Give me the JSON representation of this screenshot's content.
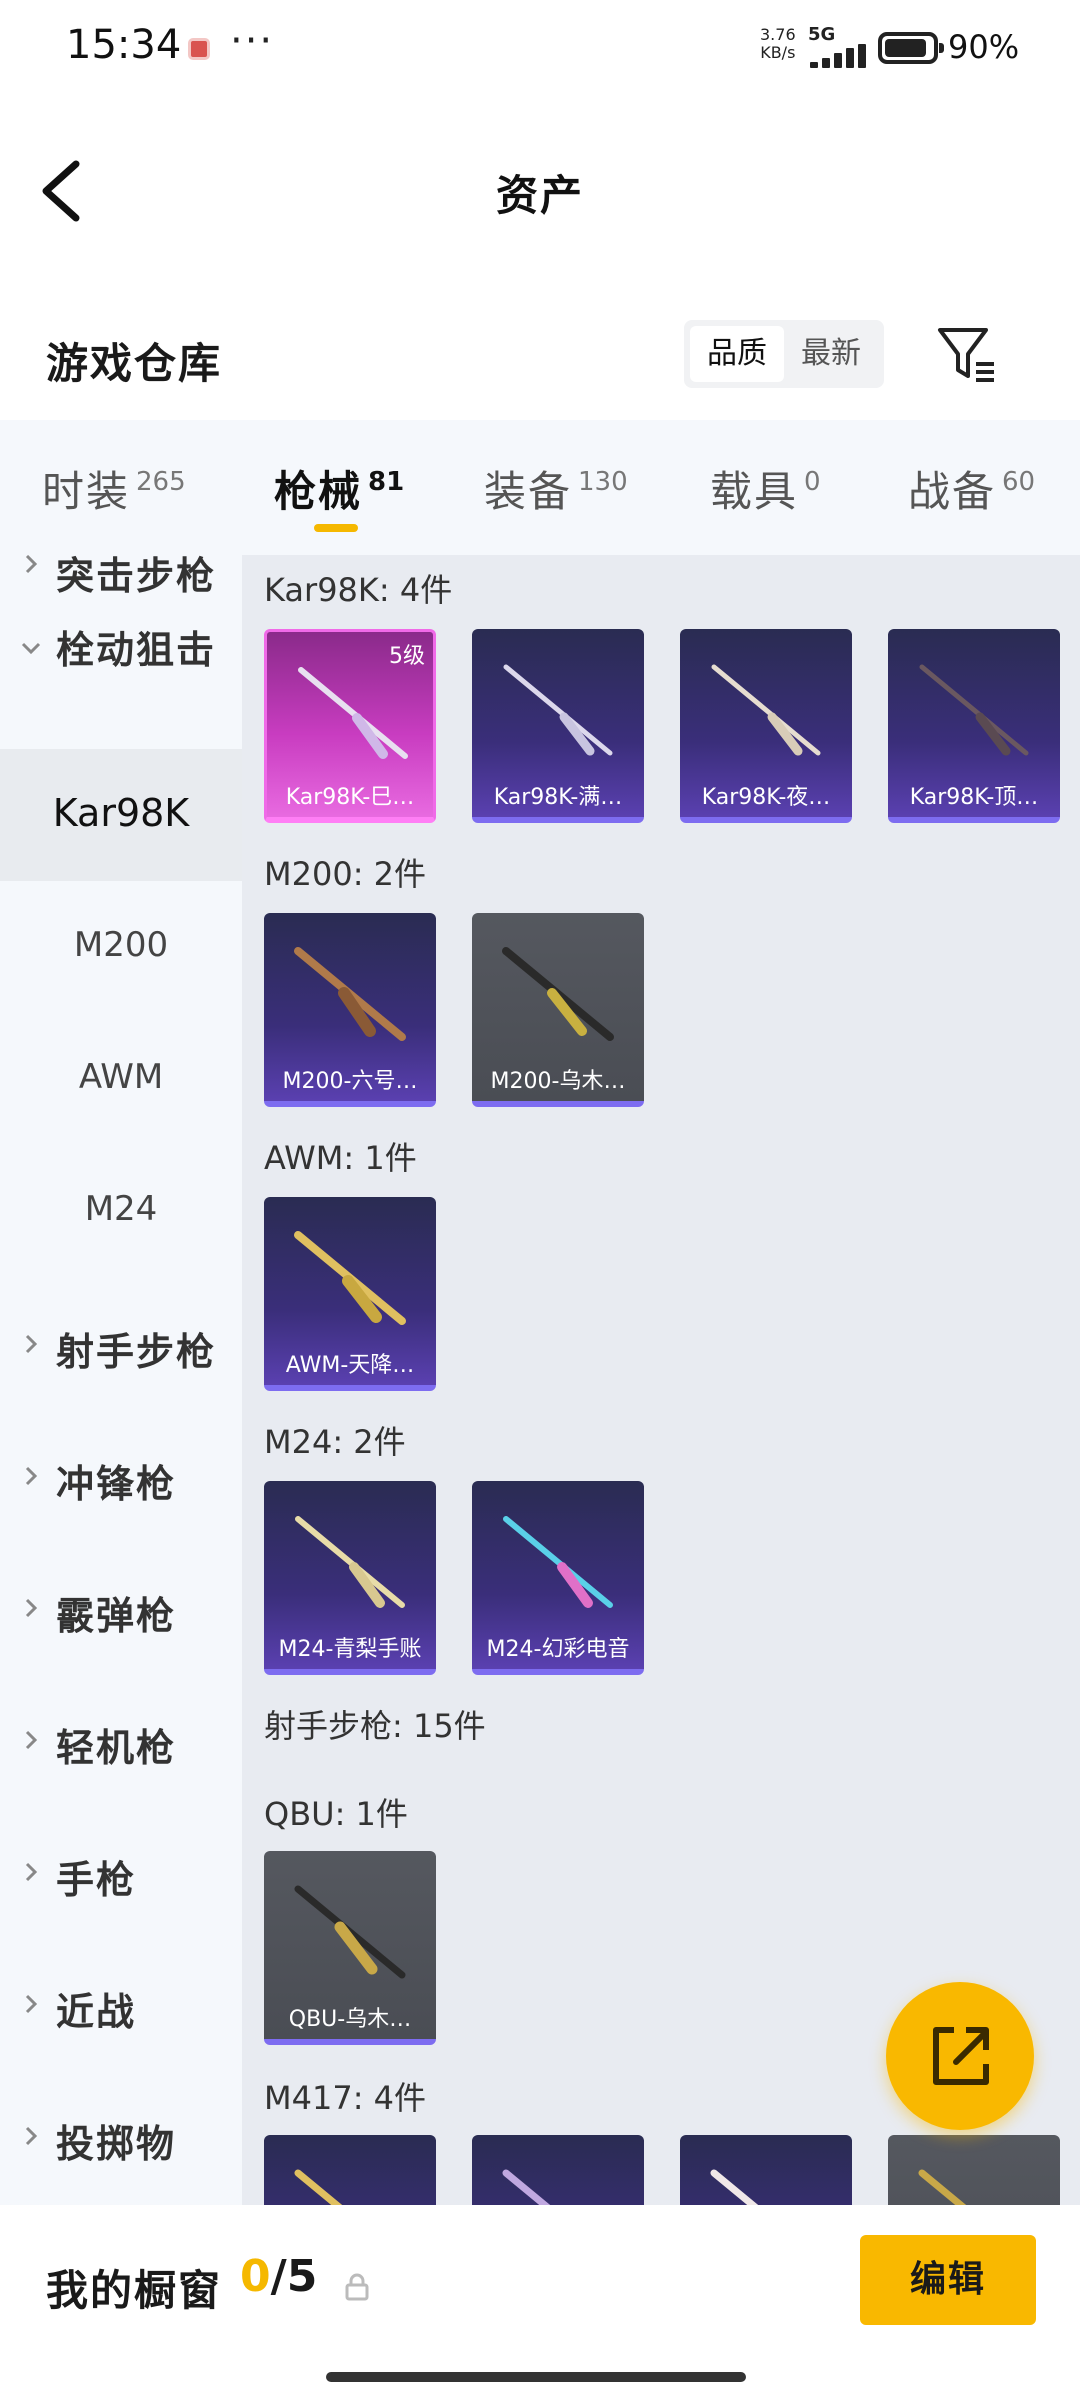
{
  "status_bar": {
    "time": "15:34",
    "more": "···",
    "net_speed_value": "3.76",
    "net_speed_unit": "KB/s",
    "network": "5G",
    "battery": "90%",
    "battery_level": 0.9
  },
  "header": {
    "title": "资产"
  },
  "warehouse": {
    "title": "游戏仓库",
    "sort_options": [
      "品质",
      "最新"
    ],
    "sort_selected": "品质"
  },
  "tabs": [
    {
      "label": "时装",
      "count": "265"
    },
    {
      "label": "枪械",
      "count": "81"
    },
    {
      "label": "装备",
      "count": "130"
    },
    {
      "label": "载具",
      "count": "0"
    },
    {
      "label": "战备",
      "count": "60"
    }
  ],
  "active_tab": "枪械",
  "sidebar": {
    "partial_top": "突击步枪",
    "expanded_category": "栓动狙击",
    "subitems": [
      "Kar98K",
      "M200",
      "AWM",
      "M24"
    ],
    "active_subitem": "Kar98K",
    "categories": [
      "射手步枪",
      "冲锋枪",
      "霰弹枪",
      "轻机枪",
      "手枪",
      "近战",
      "投掷物"
    ]
  },
  "groups": [
    {
      "label": "Kar98K: 4件",
      "items": [
        {
          "name": "Kar98K-巳…",
          "level": "5级",
          "rarity": "pink"
        },
        {
          "name": "Kar98K-满…",
          "rarity": "purple"
        },
        {
          "name": "Kar98K-夜…",
          "rarity": "purple"
        },
        {
          "name": "Kar98K-顶…",
          "rarity": "purple"
        }
      ]
    },
    {
      "label": "M200: 2件",
      "items": [
        {
          "name": "M200-六号…",
          "rarity": "purple"
        },
        {
          "name": "M200-乌木…",
          "rarity": "gray"
        }
      ]
    },
    {
      "label": "AWM: 1件",
      "items": [
        {
          "name": "AWM-天降…",
          "rarity": "purple"
        }
      ]
    },
    {
      "label": "M24: 2件",
      "items": [
        {
          "name": "M24-青梨手账",
          "rarity": "purple"
        },
        {
          "name": "M24-幻彩电音",
          "rarity": "purple"
        }
      ]
    }
  ],
  "marksman_section": "射手步枪: 15件",
  "groups2": [
    {
      "label": "QBU: 1件",
      "items": [
        {
          "name": "QBU-乌木…",
          "rarity": "gray"
        }
      ]
    },
    {
      "label": "M417: 4件",
      "items": [
        {
          "rarity": "purple"
        },
        {
          "rarity": "purple"
        },
        {
          "rarity": "purple"
        },
        {
          "rarity": "gray"
        }
      ]
    }
  ],
  "showcase": {
    "label": "我的橱窗",
    "current": "0",
    "separator": "/",
    "max": "5",
    "edit_label": "编辑"
  },
  "colors": {
    "accent": "#f9b800",
    "purple_card": "#3a2e7a",
    "pink_card": "#c83cc0",
    "gray_card": "#4a4d54"
  }
}
